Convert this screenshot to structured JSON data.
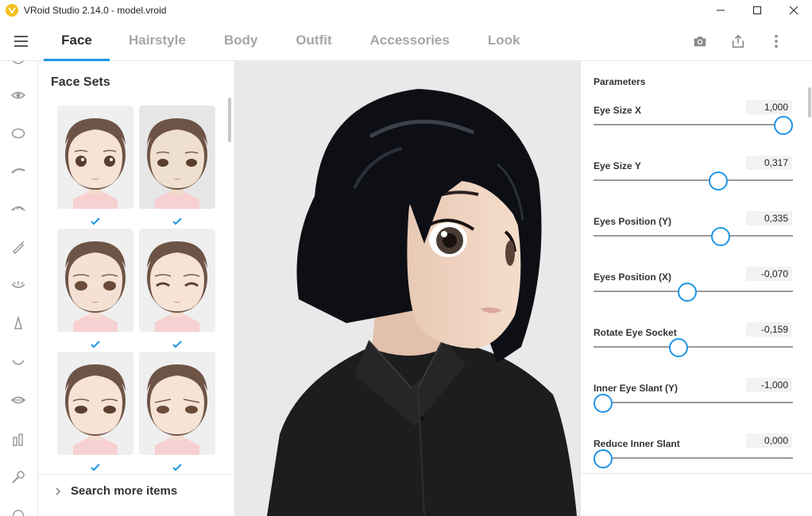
{
  "window": {
    "title": "VRoid Studio 2.14.0 - model.vroid",
    "minimize_icon": "minimize-icon",
    "maximize_icon": "maximize-icon",
    "close_icon": "close-icon"
  },
  "tabs": [
    {
      "label": "Face",
      "active": true
    },
    {
      "label": "Hairstyle",
      "active": false
    },
    {
      "label": "Body",
      "active": false
    },
    {
      "label": "Outfit",
      "active": false
    },
    {
      "label": "Accessories",
      "active": false
    },
    {
      "label": "Look",
      "active": false
    }
  ],
  "toolbar_icons": [
    "camera-icon",
    "export-icon",
    "more-vertical-icon"
  ],
  "rail_icons": [
    "face-top-icon",
    "eye-icon",
    "face-outline-icon",
    "eyebrow-icon",
    "eyelash-icon",
    "eyeliner-icon",
    "eye-closed-icon",
    "nose-icon",
    "mouth-icon",
    "lips-icon",
    "teeth-icon",
    "brush-icon",
    "ear-icon"
  ],
  "face_sets": {
    "title": "Face Sets",
    "search_more": "Search more items",
    "items": [
      {
        "selected": true
      },
      {
        "selected": true
      },
      {
        "selected": true
      },
      {
        "selected": true
      },
      {
        "selected": true
      },
      {
        "selected": true
      }
    ]
  },
  "parameters": {
    "title": "Parameters",
    "items": [
      {
        "label": "Eye Size X",
        "value": "1,000",
        "level": 1.0
      },
      {
        "label": "Eye Size Y",
        "value": "0,317",
        "level": 0.64
      },
      {
        "label": "Eyes Position (Y)",
        "value": "0,335",
        "level": 0.65
      },
      {
        "label": "Eyes Position (X)",
        "value": "-0,070",
        "level": 0.465
      },
      {
        "label": "Rotate Eye Socket",
        "value": "-0,159",
        "level": 0.42
      },
      {
        "label": "Inner Eye Slant (Y)",
        "value": "-1,000",
        "level": 0.0
      },
      {
        "label": "Reduce Inner Slant",
        "value": "0,000",
        "level": 0.0
      }
    ]
  },
  "colors": {
    "accent": "#1f95e6",
    "hair": "#0d0f14",
    "skin": "#f1d7c3",
    "shirt": "#1c1c1e"
  }
}
